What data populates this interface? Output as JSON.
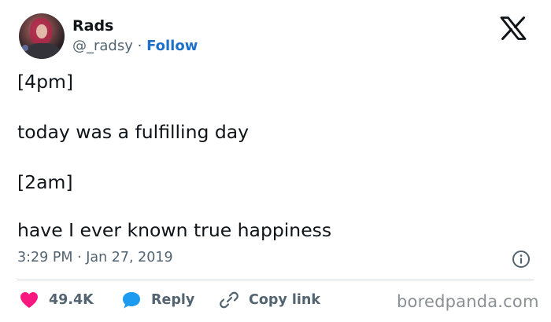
{
  "author": {
    "display_name": "Rads",
    "handle": "@_radsy",
    "separator": " · ",
    "follow_label": "Follow"
  },
  "logo_icon": "x-logo-icon",
  "tweet": {
    "lines": [
      "[4pm]",
      "today was a fulfilling day",
      "[2am]",
      "have I ever known true happiness"
    ],
    "timestamp": "3:29 PM · Jan 27, 2019"
  },
  "actions": {
    "likes_count": "49.4K",
    "reply_label": "Reply",
    "copy_link_label": "Copy link"
  },
  "icons": {
    "like": "heart-icon",
    "reply": "speech-bubble-icon",
    "copy_link": "chain-link-icon",
    "info": "info-icon"
  },
  "colors": {
    "like": "#f91880",
    "reply": "#1d9bf0",
    "follow": "#1d70c9",
    "secondary_text": "#536471"
  },
  "watermark": "boredpanda.com"
}
